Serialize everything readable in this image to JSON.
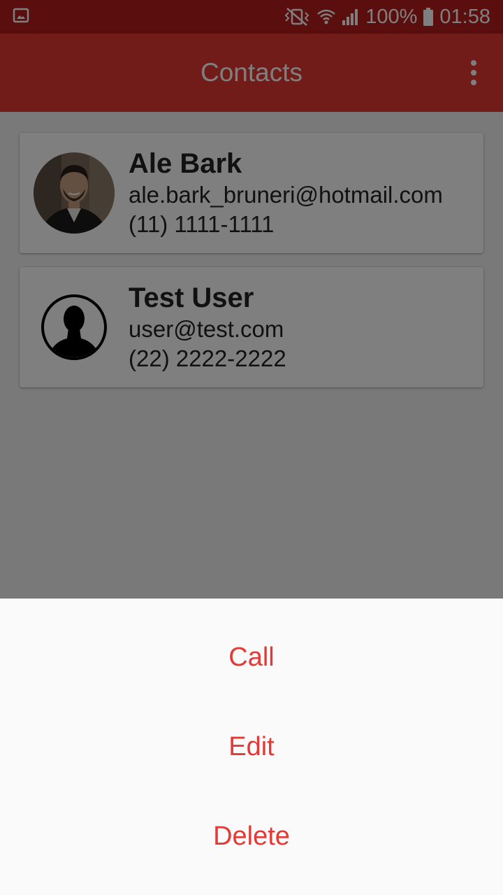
{
  "status_bar": {
    "battery": "100%",
    "time": "01:58",
    "icons": [
      "gallery-icon",
      "vibrate-icon",
      "wifi-icon",
      "signal-icon",
      "battery-icon"
    ]
  },
  "app_bar": {
    "title": "Contacts",
    "menu_icon": "more-vert-icon"
  },
  "contacts": [
    {
      "name": "Ale Bark",
      "email": "ale.bark_bruneri@hotmail.com",
      "phone": "(11) 1111-1111",
      "avatar": "photo"
    },
    {
      "name": "Test User",
      "email": "user@test.com",
      "phone": "(22) 2222-2222",
      "avatar": "person-silhouette-icon"
    }
  ],
  "bottom_sheet": {
    "actions": [
      "Call",
      "Edit",
      "Delete"
    ]
  },
  "colors": {
    "primary": "#e53935",
    "primary_dark": "#b71c1c",
    "action_text": "#e53935"
  }
}
